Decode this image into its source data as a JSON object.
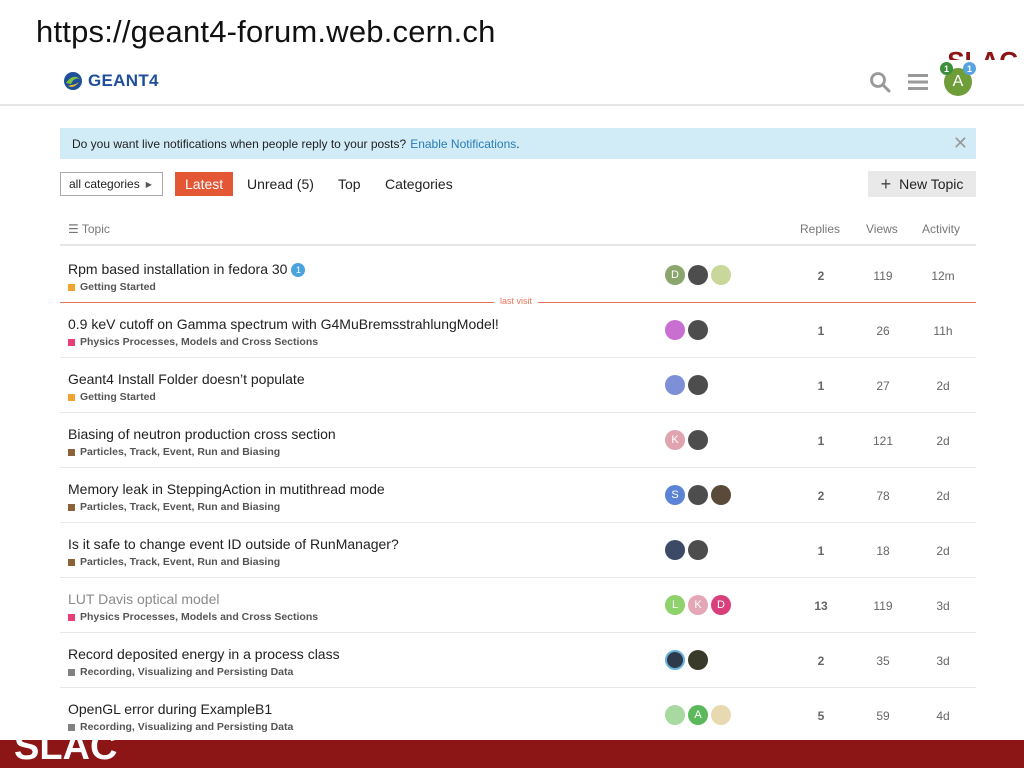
{
  "slide": {
    "url": "https://geant4-forum.web.cern.ch",
    "brand": "SLAC",
    "footer_brand": "SLAC"
  },
  "header": {
    "logo_text": "GEANT4",
    "user_initial": "A",
    "badge_green": "1",
    "badge_blue": "1"
  },
  "notice": {
    "text": "Do you want live notifications when people reply to your posts?",
    "link": "Enable Notifications",
    "suffix": ".",
    "close": "✕"
  },
  "nav": {
    "category_select": "all categories",
    "tabs": [
      "Latest",
      "Unread (5)",
      "Top",
      "Categories"
    ],
    "new_topic": "New Topic"
  },
  "table_header": {
    "topic": "Topic",
    "replies": "Replies",
    "views": "Views",
    "activity": "Activity"
  },
  "last_visit": "last visit",
  "colors": {
    "accent": "#e45735",
    "getting_started": "#f0a330",
    "physics": "#e83e7a",
    "particles": "#8c6239",
    "recording": "#808281"
  },
  "topics": [
    {
      "title": "Rpm based installation in fedora 30",
      "new_count": "1",
      "category": "Getting Started",
      "posters": [
        "D",
        "",
        ""
      ],
      "replies": "2",
      "views": "119",
      "activity": "12m"
    },
    {
      "title": "0.9 keV cutoff on Gamma spectrum with G4MuBremsstrahlungModel!",
      "category": "Physics Processes, Models and Cross Sections",
      "posters": [
        "",
        ""
      ],
      "replies": "1",
      "views": "26",
      "activity": "11h"
    },
    {
      "title": "Geant4 Install Folder doesn’t populate",
      "category": "Getting Started",
      "posters": [
        "",
        ""
      ],
      "replies": "1",
      "views": "27",
      "activity": "2d"
    },
    {
      "title": "Biasing of neutron production cross section",
      "category": "Particles, Track, Event, Run and Biasing",
      "posters": [
        "K",
        ""
      ],
      "replies": "1",
      "views": "121",
      "activity": "2d"
    },
    {
      "title": "Memory leak in SteppingAction in mutithread mode",
      "category": "Particles, Track, Event, Run and Biasing",
      "posters": [
        "S",
        "",
        ""
      ],
      "replies": "2",
      "views": "78",
      "activity": "2d"
    },
    {
      "title": "Is it safe to change event ID outside of RunManager?",
      "category": "Particles, Track, Event, Run and Biasing",
      "posters": [
        "",
        ""
      ],
      "replies": "1",
      "views": "18",
      "activity": "2d"
    },
    {
      "title": "LUT Davis optical model",
      "category": "Physics Processes, Models and Cross Sections",
      "posters": [
        "L",
        "K",
        "D"
      ],
      "replies": "13",
      "views": "119",
      "activity": "3d"
    },
    {
      "title": "Record deposited energy in a process class",
      "category": "Recording, Visualizing and Persisting Data",
      "posters": [
        "",
        ""
      ],
      "replies": "2",
      "views": "35",
      "activity": "3d"
    },
    {
      "title": "OpenGL error during ExampleB1",
      "category": "Recording, Visualizing and Persisting Data",
      "posters": [
        "",
        "A",
        ""
      ],
      "replies": "5",
      "views": "59",
      "activity": "4d"
    }
  ]
}
